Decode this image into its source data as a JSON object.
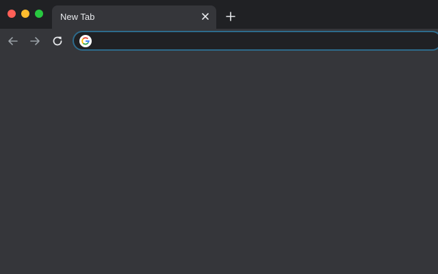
{
  "window": {
    "traffic_lights": {
      "close_color": "#ff5f57",
      "minimize_color": "#febc2e",
      "maximize_color": "#28c840"
    }
  },
  "tabs": [
    {
      "title": "New Tab",
      "active": true,
      "close_icon": "close-icon"
    }
  ],
  "new_tab_icon": "plus-icon",
  "toolbar": {
    "back_icon": "arrow-left-icon",
    "forward_icon": "arrow-right-icon",
    "reload_icon": "reload-icon"
  },
  "omnibox": {
    "icon": "google-g-icon",
    "value": "",
    "placeholder": "",
    "focus_color": "#2d6b8c"
  },
  "colors": {
    "frame": "#202124",
    "toolbar": "#35363a",
    "text": "#e8eaed",
    "icon": "#e8eaed",
    "icon_disabled": "#9aa0a6"
  }
}
